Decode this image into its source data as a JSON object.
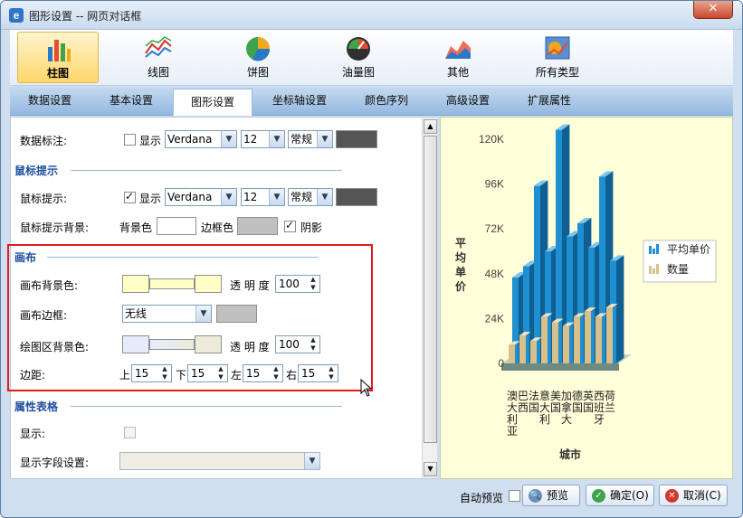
{
  "window": {
    "title": "图形设置 -- 网页对话框",
    "close": "✕"
  },
  "chart_types": [
    {
      "label": "柱图",
      "icon": "bar-chart-icon",
      "active": true
    },
    {
      "label": "线图",
      "icon": "line-chart-icon"
    },
    {
      "label": "饼图",
      "icon": "pie-chart-icon"
    },
    {
      "label": "油量图",
      "icon": "gauge-chart-icon"
    },
    {
      "label": "其他",
      "icon": "other-chart-icon"
    },
    {
      "label": "所有类型",
      "icon": "all-types-chart-icon"
    }
  ],
  "tabs": [
    "数据设置",
    "基本设置",
    "图形设置",
    "坐标轴设置",
    "颜色序列",
    "高级设置",
    "扩展属性"
  ],
  "active_tab": "图形设置",
  "settings": {
    "data_label": {
      "label": "数据标注:",
      "show": "显示",
      "show_checked": false,
      "font": "Verdana",
      "size": "12",
      "style": "常规"
    },
    "tooltip_section": "鼠标提示",
    "tooltip": {
      "label": "鼠标提示:",
      "show": "显示",
      "show_checked": true,
      "font": "Verdana",
      "size": "12",
      "style": "常规"
    },
    "tooltip_bg": {
      "label": "鼠标提示背景:",
      "bg": "背景色",
      "border": "边框色",
      "shadow": "阴影",
      "shadow_checked": true
    },
    "canvas_section": "画布",
    "canvas_bg": {
      "label": "画布背景色:",
      "opacity_label": "透 明 度",
      "opacity": "100"
    },
    "canvas_border": {
      "label": "画布边框:",
      "value": "无线"
    },
    "plot_bg": {
      "label": "绘图区背景色:",
      "opacity_label": "透 明 度",
      "opacity": "100"
    },
    "margin": {
      "label": "边距:",
      "top_label": "上",
      "top": "15",
      "bottom_label": "下",
      "bottom": "15",
      "left_label": "左",
      "left": "15",
      "right_label": "右",
      "right": "15"
    },
    "attr_section": "属性表格",
    "attr_show": {
      "label": "显示:"
    },
    "attr_fields": {
      "label": "显示字段设置:"
    }
  },
  "colors": {
    "accent": "#1f4e9e",
    "highlight": "#e21b1b",
    "preview_bg": "#ffffd9",
    "series1": "#1e8fd0",
    "series2": "#d9c08a"
  },
  "chart_data": {
    "type": "bar",
    "categories": [
      "澳大利亚",
      "巴西",
      "法国",
      "意大利",
      "美国",
      "加拿大",
      "德国",
      "英国",
      "西班牙",
      "荷兰"
    ],
    "x_tick_labels": [
      "澳大利亚",
      "巴西",
      "法国",
      "意大利",
      "美国",
      "加拿大",
      "德国",
      "英国",
      "西班牙",
      "荷兰"
    ],
    "series": [
      {
        "name": "平均单价",
        "values": [
          46000,
          52000,
          95000,
          60000,
          125000,
          68000,
          75000,
          62000,
          100000,
          55000
        ]
      },
      {
        "name": "数量",
        "values": [
          10000,
          15000,
          12000,
          25000,
          22000,
          20000,
          25000,
          28000,
          25000,
          30000
        ]
      }
    ],
    "ylabel": "平均单价",
    "xlabel": "城市",
    "y_ticks": [
      "0",
      "24K",
      "48K",
      "72K",
      "96K",
      "120K"
    ],
    "ylim": [
      0,
      120000
    ],
    "legend_position": "right",
    "style": "3d-bar"
  },
  "footer": {
    "auto_preview": "自动预览",
    "preview": "预览",
    "ok": "确定(O)",
    "cancel": "取消(C)"
  }
}
